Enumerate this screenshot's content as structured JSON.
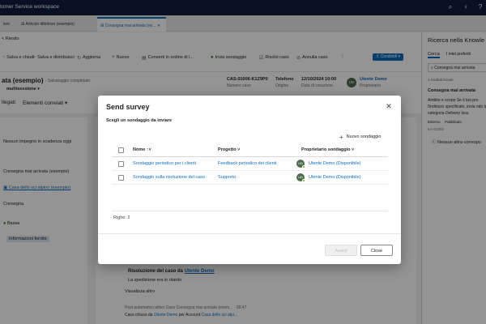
{
  "topbar": {
    "app_title": "tomer Service workspace"
  },
  "tabs": [
    {
      "label": "tivo"
    },
    {
      "label": "Articolo difettoso (esempio)"
    },
    {
      "label": "Consegna mai arrivata (es..."
    }
  ],
  "ribbon": {
    "breadcrumb": "< Riesito",
    "commands": [
      "Salva e chiudi",
      "Salva e distribuisci",
      "Aggiorna",
      "Nuovo",
      "Converti in ordine di l...",
      "Invia sondaggio",
      "Risolvi caso",
      "Annulla caso"
    ],
    "share_label": "Condividi"
  },
  "record": {
    "title": "ata (esempio)",
    "saved_status": "- Salvataggio completato",
    "subtitle": "multisessione",
    "case_number": "CAS-01006-K1Z9P0",
    "case_number_label": "Numero caso",
    "origin": "Telefono",
    "origin_label": "Origine",
    "created_on": "12/10/2024 10:00",
    "created_on_label": "Data di creazione",
    "owner": "Utente Demo",
    "owner_label": "Proprietario",
    "tab_attachments": "llegati",
    "tab_related": "Elementi correlati"
  },
  "left": {
    "no_commitments": "Nessun impegno in scadenza oggi",
    "case_title": "Consegna mai arrivata (esempio)",
    "account_link": "Casa dello sci alpino (esempio)",
    "delivery": "Consegna",
    "priority": "Bassa",
    "info": "Informazioni fornite"
  },
  "timeline": {
    "resolution_title": "Risoluzione del caso da",
    "resolution_user": "Utente Demo",
    "resolution_text": "La spedizione era in ritardo",
    "see_more": "Visualizza altro",
    "post_line1": "Post automatico attivo Caso Consegna mai arrivata (esem... · 09:47",
    "post_line2_prefix": "Caso chiuso da",
    "post_user": "Utente Demo",
    "post_mid": "per Account",
    "post_account": "Casa dello sci alpi..."
  },
  "right_pane": {
    "title": "Ricerca nella Knowle",
    "tab_search": "Cerca",
    "tab_favorites": "I miei preferiti",
    "search_value": "Consegna mai arrivata",
    "results": "1 risultati trovati",
    "article_title": "Consegna mai arrivata",
    "article_text": "Ambito e scopo Se il tuo pro l'indirizzo specificato, invia ndo la categoria Delivery Issu",
    "tag_external": "Esterno",
    "tag_published": "Pubblicato",
    "kb_id": "KA-01002",
    "no_other": "Nessun altra correspo"
  },
  "dialog": {
    "title": "Send survey",
    "subtitle": "Scegli un sondaggio da inviare",
    "new_survey": "Nuovo sondaggio",
    "columns": {
      "name": "Nome",
      "project": "Progetto",
      "owner": "Proprietario sondaggio"
    },
    "rows": [
      {
        "name": "Sondaggio periodico per i clienti",
        "project": "Feedback periodico dei clienti",
        "owner": "Utente Demo (Disponibile)",
        "avatar": "UD"
      },
      {
        "name": "Sondaggio sulla risoluzione del caso",
        "project": "Supporto",
        "owner": "Utente Demo (Disponibile)",
        "avatar": "UD"
      }
    ],
    "row_count": "Righe: 2",
    "next_label": "Avanti",
    "close_label": "Close"
  }
}
